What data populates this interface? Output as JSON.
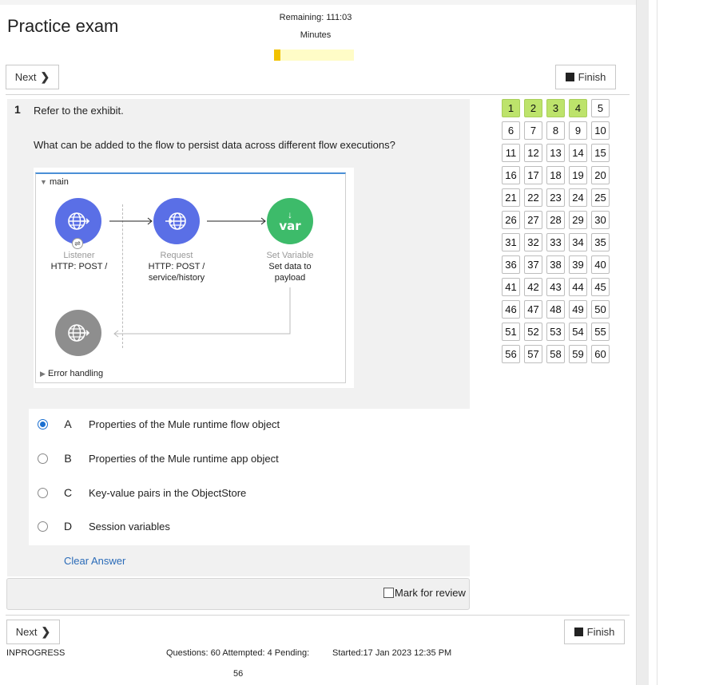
{
  "header": {
    "title": "Practice exam",
    "remaining": "Remaining: 111:03",
    "minutes": "Minutes",
    "time_progress": 0.08
  },
  "buttons": {
    "next": "Next",
    "finish": "Finish"
  },
  "question": {
    "number": "1",
    "text1": "Refer to the exhibit.",
    "text2": "What can be added to the flow to persist data across different flow executions?"
  },
  "exhibit": {
    "flow_name": "main",
    "listener_label": "Listener",
    "listener_config": "HTTP: POST /",
    "request_label": "Request",
    "request_config_1": "HTTP: POST /",
    "request_config_2": "service/history",
    "setvar_label": "Set Variable",
    "setvar_config_1": "Set data to",
    "setvar_config_2": "payload",
    "setvar_icon_text": "var",
    "error_handling": "Error handling",
    "colors": {
      "blue_node": "#5a6fe6",
      "green_node": "#3dbb6a",
      "gray_node": "#8e8e8e"
    }
  },
  "answers": [
    {
      "letter": "A",
      "text": "Properties of the Mule runtime flow object",
      "selected": true
    },
    {
      "letter": "B",
      "text": "Properties of the Mule runtime app object",
      "selected": false
    },
    {
      "letter": "C",
      "text": "Key-value pairs in the ObjectStore",
      "selected": false
    },
    {
      "letter": "D",
      "text": "Session variables",
      "selected": false
    }
  ],
  "clear_answer": "Clear Answer",
  "mark_for_review": "Mark for review",
  "navigator": {
    "numbers": [
      "1",
      "2",
      "3",
      "4",
      "5",
      "6",
      "7",
      "8",
      "9",
      "10",
      "11",
      "12",
      "13",
      "14",
      "15",
      "16",
      "17",
      "18",
      "19",
      "20",
      "21",
      "22",
      "23",
      "24",
      "25",
      "26",
      "27",
      "28",
      "29",
      "30",
      "31",
      "32",
      "33",
      "34",
      "35",
      "36",
      "37",
      "38",
      "39",
      "40",
      "41",
      "42",
      "43",
      "44",
      "45",
      "46",
      "47",
      "48",
      "49",
      "50",
      "51",
      "52",
      "53",
      "54",
      "55",
      "56",
      "57",
      "58",
      "59",
      "60"
    ],
    "attempted": [
      "1",
      "2",
      "3",
      "4"
    ]
  },
  "footer": {
    "status": "INPROGRESS",
    "questions_info": "Questions: 60 Attempted: 4 Pending:",
    "pending": "56",
    "started": "Started:17 Jan 2023 12:35 PM"
  }
}
